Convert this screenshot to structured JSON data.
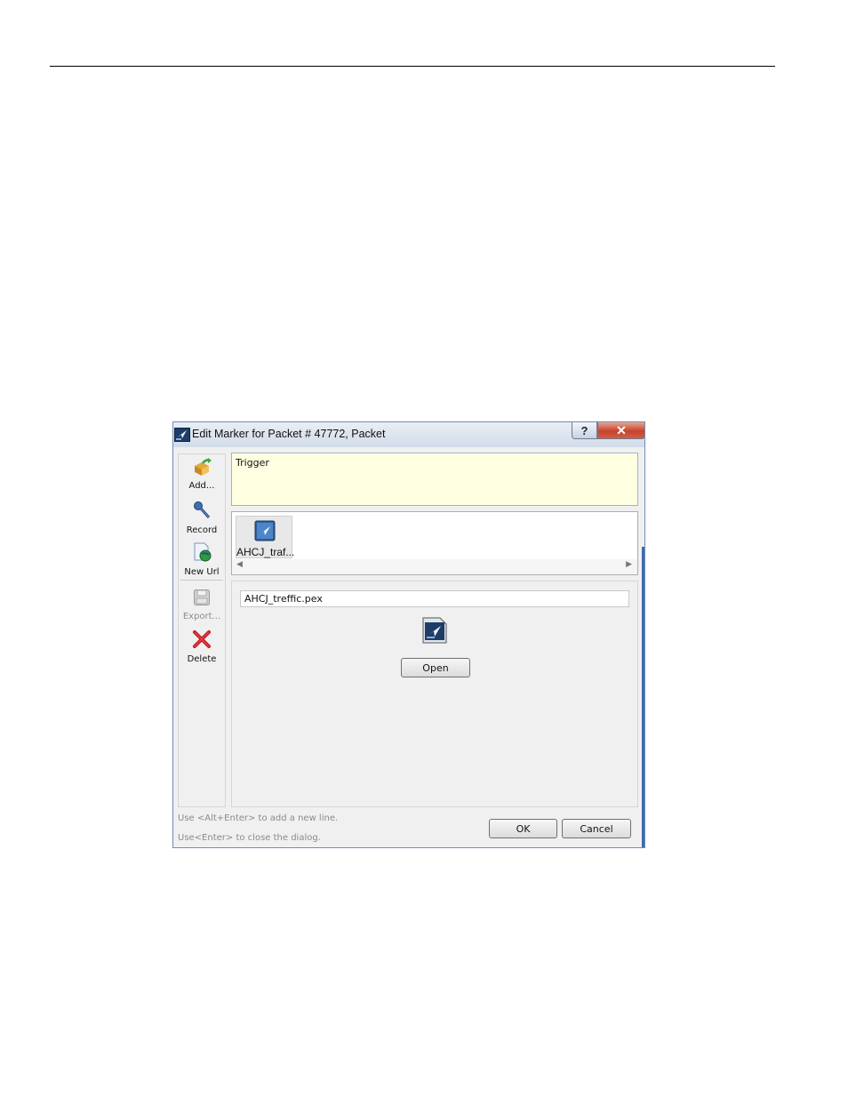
{
  "dialog": {
    "title": "Edit Marker for Packet # 47772, Packet",
    "help_label": "?",
    "close_label": "✕"
  },
  "toolbar": {
    "add_label": "Add...",
    "record_label": "Record",
    "new_url_label": "New Url",
    "export_label": "Export...",
    "delete_label": "Delete"
  },
  "marker_text": "Trigger",
  "attachments": [
    {
      "name": "AHCJ_traf..."
    }
  ],
  "details": {
    "filename": "AHCJ_treffic.pex",
    "open_label": "Open"
  },
  "hints": {
    "line1": "Use <Alt+Enter> to add a new line.",
    "line2": "Use<Enter> to close the dialog."
  },
  "buttons": {
    "ok_label": "OK",
    "cancel_label": "Cancel"
  },
  "colors": {
    "text_area_bg": "#ffffe1",
    "close_button": "#c7432b",
    "title_bar": "#d2dbe8"
  }
}
